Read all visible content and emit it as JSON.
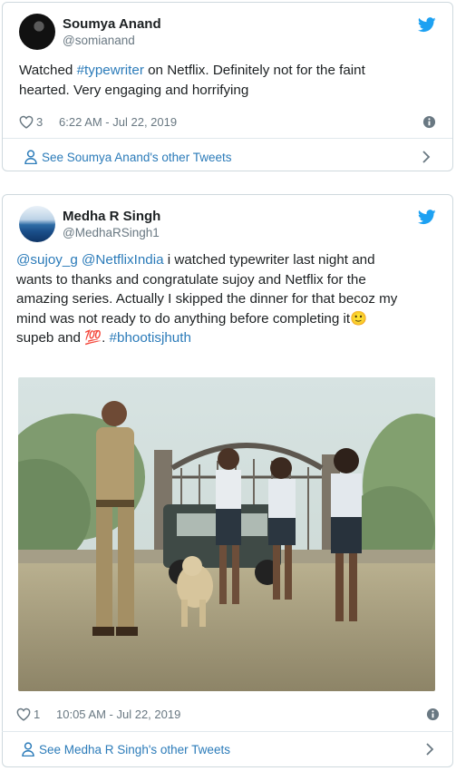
{
  "tweets": [
    {
      "name": "Soumya Anand",
      "handle": "@somianand",
      "text": {
        "l1_a": "Watched ",
        "l1_link": "#typewriter",
        "l1_b": " on Netflix. Definitely not for the faint",
        "l2": "hearted. Very engaging and horrifying"
      },
      "likes": "3",
      "time": "6:22 AM - Jul 22, 2019",
      "footer": "See Soumya Anand's other Tweets"
    },
    {
      "name": "Medha R Singh",
      "handle": "@MedhaRSingh1",
      "text": {
        "l1_m1": "@sujoy_g",
        "l1_sp": " ",
        "l1_m2": "@NetflixIndia",
        "l1_rest": " i watched typewriter last night and",
        "l2": "wants to thanks and congratulate sujoy and Netflix for the",
        "l3": "amazing series. Actually I skipped the dinner for that becoz my",
        "l4_a": "mind was not  ready to do anything before completing it",
        "l4_emoji": "🙂",
        "l5_a": "supeb  and ",
        "l5_emoji": "💯",
        "l5_b": ". ",
        "l5_tag": "#bhootisjhuth"
      },
      "likes": "1",
      "time": "10:05 AM - Jul 22, 2019",
      "footer": "See Medha R Singh's other Tweets"
    }
  ],
  "icons": {
    "brand": "twitter-bird-icon",
    "like": "heart-icon",
    "info": "info-icon",
    "profile": "person-icon",
    "more": "chevron-right-icon"
  },
  "colors": {
    "link": "#2b7bb9",
    "twitter_blue": "#1da1f2",
    "meta_gray": "#697882",
    "border": "#cfd9de"
  }
}
